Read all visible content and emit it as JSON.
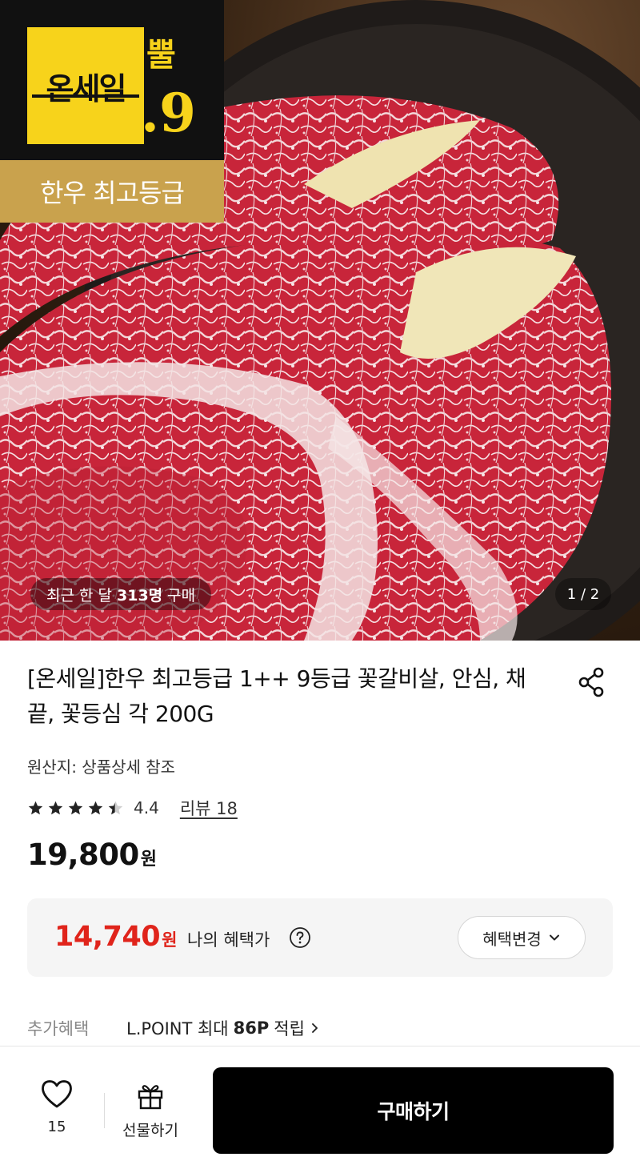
{
  "hero": {
    "badge_main": "온세일",
    "badge_side_top": "뿔",
    "badge_side_bottom": ".9",
    "badge_grade": "한우 최고등급",
    "recent_prefix": "최근 한 달",
    "recent_count": "313명",
    "recent_suffix": "구매",
    "pager": "1 / 2"
  },
  "product": {
    "title": "[온세일]한우 최고등급 1++ 9등급 꽃갈비살, 안심, 채끝, 꽃등심 각 200G",
    "origin": "원산지: 상품상세 참조",
    "rating": 4.4,
    "rating_text": "4.4",
    "review_link": "리뷰 18",
    "price": "19,800",
    "price_unit": "원"
  },
  "benefit": {
    "price": "14,740",
    "price_unit": "원",
    "label": "나의 혜택가",
    "change_button": "혜택변경"
  },
  "extra_benefit": {
    "label": "추가혜택",
    "prefix": "L.POINT 최대",
    "points": "86P",
    "suffix": "적립"
  },
  "bottom_bar": {
    "wish_count": "15",
    "gift_label": "선물하기",
    "buy_label": "구매하기"
  },
  "colors": {
    "badge_yellow": "#f7d31b",
    "badge_gold": "#c9a24d",
    "benefit_red": "#e0241b",
    "buy_button": "#000000"
  }
}
